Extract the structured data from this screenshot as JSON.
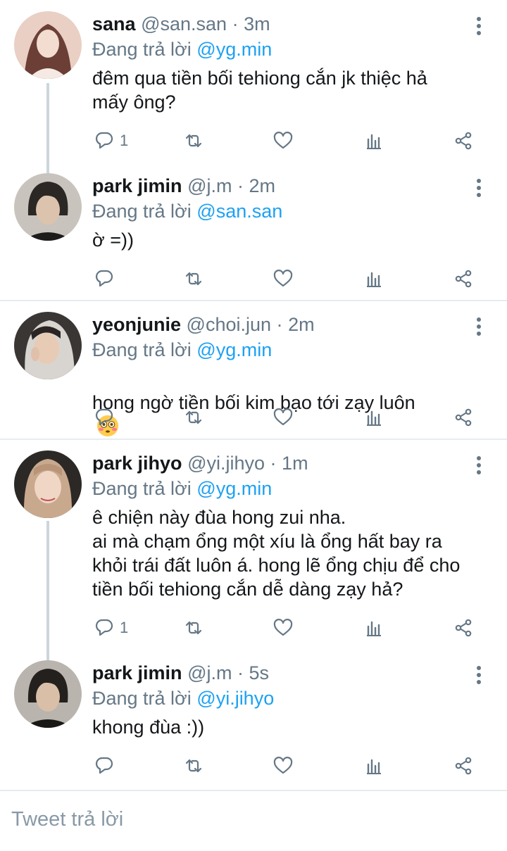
{
  "colors": {
    "accent": "#1da1f2",
    "muted": "#657786",
    "thread_line": "#ccd6dd"
  },
  "replying_prefix": "Đang trả lời",
  "tweets": [
    {
      "name": "sana",
      "handle": "@san.san",
      "time": "3m",
      "reply_to": "@yg.min",
      "text": " đêm qua tiền bối tehiong cắn jk thiệc hả\nmấy ông?",
      "reply_count": "1"
    },
    {
      "name": "park jimin",
      "handle": "@j.m",
      "time": "2m",
      "reply_to": "@san.san",
      "text": "ờ =))",
      "reply_count": ""
    },
    {
      "name": "yeonjunie",
      "handle": "@choi.jun",
      "time": "2m",
      "reply_to": "@yg.min",
      "text": "hong ngờ tiền bối kim bạo tới zạy luôn",
      "emoji": "flushed-face-emoji",
      "reply_count": ""
    },
    {
      "name": "park jihyo",
      "handle": "@yi.jihyo",
      "time": "1m",
      "reply_to": "@yg.min",
      "text": "ê chiện này đùa hong zui nha.\nai mà chạm ổng một xíu là ổng hất bay ra\nkhỏi trái đất luôn á. hong lẽ ổng chịu để cho\ntiền bối tehiong cắn dễ dàng zạy hả?",
      "reply_count": "1"
    },
    {
      "name": "park jimin",
      "handle": "@j.m",
      "time": "5s",
      "reply_to": "@yi.jihyo",
      "text": "khong đùa :))",
      "reply_count": ""
    }
  ],
  "compose": {
    "placeholder": "Tweet trả lời"
  }
}
